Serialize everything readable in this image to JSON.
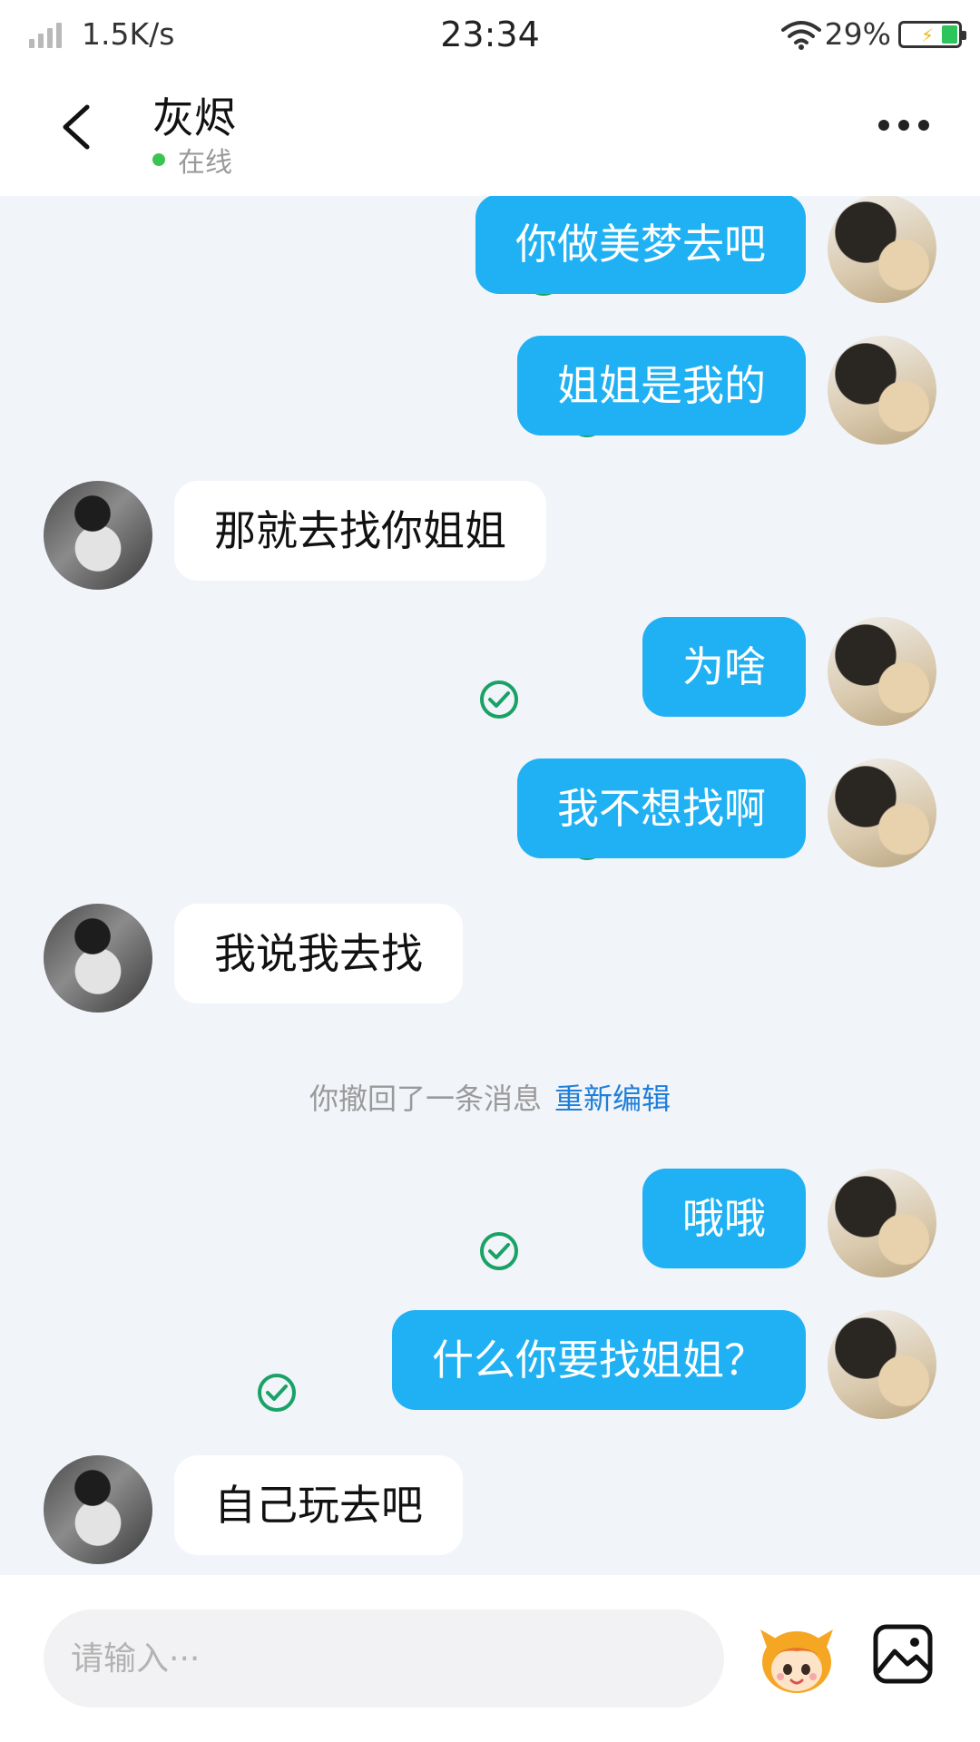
{
  "status_bar": {
    "speed": "1.5K/s",
    "time": "23:34",
    "battery": "29%",
    "battery_level": 0.29
  },
  "header": {
    "contact_name": "灰烬",
    "status": "在线"
  },
  "messages": [
    {
      "from": "me",
      "text": "你做美梦去吧",
      "status": "read"
    },
    {
      "from": "me",
      "text": "姐姐是我的",
      "status": "read"
    },
    {
      "from": "other",
      "text": "那就去找你姐姐"
    },
    {
      "from": "me",
      "text": "为啥",
      "status": "read"
    },
    {
      "from": "me",
      "text": "我不想找啊",
      "status": "read"
    },
    {
      "from": "other",
      "text": "我说我去找"
    },
    {
      "from": "me",
      "text": "哦哦",
      "status": "read"
    },
    {
      "from": "me",
      "text": "什么你要找姐姐？",
      "status": "read"
    },
    {
      "from": "other",
      "text": "自己玩去吧"
    }
  ],
  "recall_notice": {
    "text": "你撤回了一条消息",
    "action": "重新编辑"
  },
  "input": {
    "placeholder": "请输入···"
  },
  "colors": {
    "bubble_me": "#1fb1f3",
    "bubble_other": "#ffffff",
    "read_tick": "#1aa266",
    "online_dot": "#3bc452",
    "link": "#1f7fd9"
  }
}
